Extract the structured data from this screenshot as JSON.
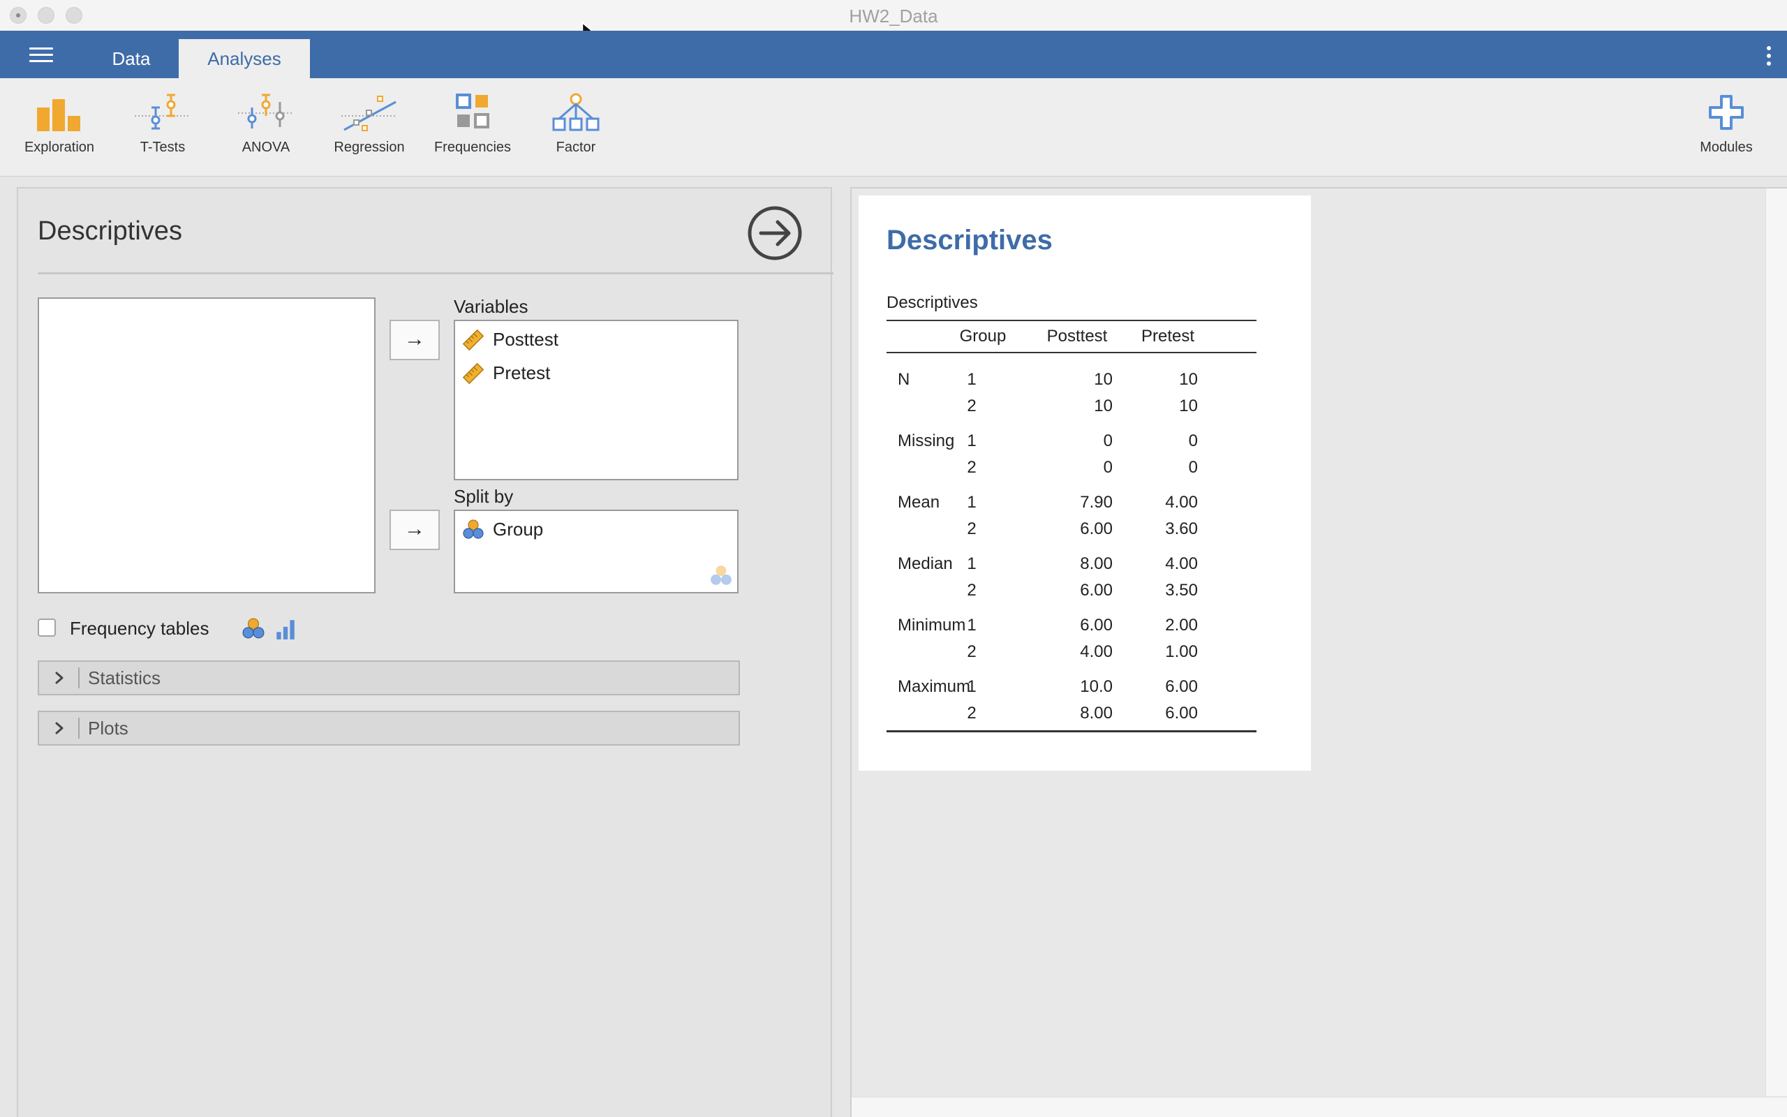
{
  "window": {
    "title": "HW2_Data"
  },
  "tabs": [
    {
      "label": "Data"
    },
    {
      "label": "Analyses"
    }
  ],
  "ribbon": {
    "items": [
      {
        "label": "Exploration",
        "icon": "exploration-icon"
      },
      {
        "label": "T-Tests",
        "icon": "t-tests-icon"
      },
      {
        "label": "ANOVA",
        "icon": "anova-icon"
      },
      {
        "label": "Regression",
        "icon": "regression-icon"
      },
      {
        "label": "Frequencies",
        "icon": "frequencies-icon"
      },
      {
        "label": "Factor",
        "icon": "factor-icon"
      }
    ],
    "modules_label": "Modules"
  },
  "options_panel": {
    "title": "Descriptives",
    "variables_label": "Variables",
    "variables": [
      "Posttest",
      "Pretest"
    ],
    "split_label": "Split by",
    "split_vars": [
      "Group"
    ],
    "frequency_tables_label": "Frequency tables",
    "frequency_tables_checked": false,
    "sections": [
      "Statistics",
      "Plots"
    ]
  },
  "results": {
    "title": "Descriptives",
    "table_caption": "Descriptives",
    "columns": [
      "",
      "Group",
      "Posttest",
      "Pretest"
    ],
    "rows": [
      {
        "stat": "N",
        "group": "1",
        "posttest": "10",
        "pretest": "10"
      },
      {
        "stat": "",
        "group": "2",
        "posttest": "10",
        "pretest": "10"
      },
      {
        "stat": "Missing",
        "group": "1",
        "posttest": "0",
        "pretest": "0"
      },
      {
        "stat": "",
        "group": "2",
        "posttest": "0",
        "pretest": "0"
      },
      {
        "stat": "Mean",
        "group": "1",
        "posttest": "7.90",
        "pretest": "4.00"
      },
      {
        "stat": "",
        "group": "2",
        "posttest": "6.00",
        "pretest": "3.60"
      },
      {
        "stat": "Median",
        "group": "1",
        "posttest": "8.00",
        "pretest": "4.00"
      },
      {
        "stat": "",
        "group": "2",
        "posttest": "6.00",
        "pretest": "3.50"
      },
      {
        "stat": "Minimum",
        "group": "1",
        "posttest": "6.00",
        "pretest": "2.00"
      },
      {
        "stat": "",
        "group": "2",
        "posttest": "4.00",
        "pretest": "1.00"
      },
      {
        "stat": "Maximum",
        "group": "1",
        "posttest": "10.0",
        "pretest": "6.00"
      },
      {
        "stat": "",
        "group": "2",
        "posttest": "8.00",
        "pretest": "6.00"
      }
    ]
  },
  "colors": {
    "accent": "#3e6ca8",
    "ribbon_orange": "#f0a830",
    "ribbon_blue": "#5a8ed6"
  }
}
